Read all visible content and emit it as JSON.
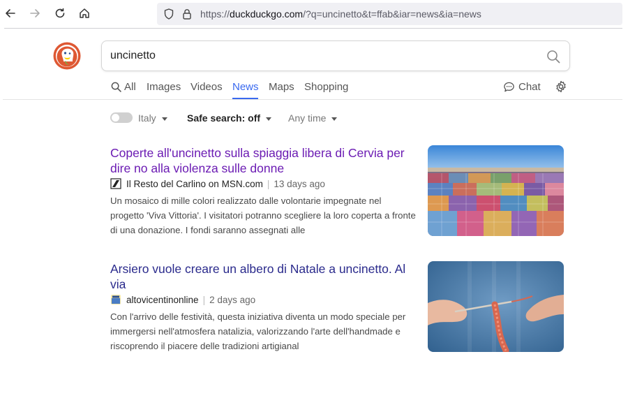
{
  "browser": {
    "url_host_prefix": "https://",
    "url_host": "duckduckgo.com",
    "url_path": "/?q=uncinetto&t=ffab&iar=news&ia=news"
  },
  "search": {
    "query": "uncinetto"
  },
  "tabs": [
    {
      "label": "All",
      "icon": "search-icon",
      "active": false
    },
    {
      "label": "Images",
      "active": false
    },
    {
      "label": "Videos",
      "active": false
    },
    {
      "label": "News",
      "active": true
    },
    {
      "label": "Maps",
      "active": false
    },
    {
      "label": "Shopping",
      "active": false
    }
  ],
  "header": {
    "chat_label": "Chat"
  },
  "filters": {
    "region": "Italy",
    "safe_search": "Safe search: off",
    "time": "Any time"
  },
  "results": [
    {
      "title": "Coperte all'uncinetto sulla spiaggia libera di Cervia per dire no alla violenza sulle donne",
      "source": "Il Resto del Carlino on MSN.com",
      "age": "13 days ago",
      "snippet": "Un mosaico di mille colori realizzato dalle volontarie impegnate nel progetto 'Viva Vittoria'. I visitatori potranno scegliere la loro coperta a fronte di una donazione. I fondi saranno assegnati alle",
      "visited": true
    },
    {
      "title": "Arsiero vuole creare un albero di Natale a uncinetto. Al via",
      "source": "altovicentinonline",
      "age": "2 days ago",
      "snippet": "Con l'arrivo delle festività, questa iniziativa diventa un modo speciale per immergersi nell'atmosfera natalizia, valorizzando l'arte dell'handmade e riscoprendo il piacere delle tradizioni artigianal",
      "visited": false
    }
  ],
  "colors": {
    "accent": "#3969ef",
    "visited_link": "#6b1bb3",
    "link": "#2a2a8c"
  }
}
